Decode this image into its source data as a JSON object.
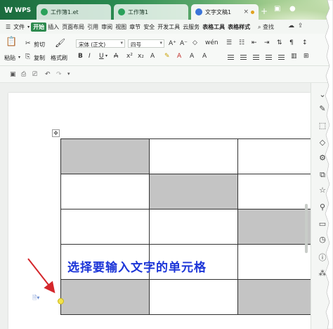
{
  "titlebar": {
    "app_label": "WPS",
    "tabs": [
      {
        "label": "工作簿1.et"
      },
      {
        "label": "工作簿1"
      },
      {
        "label": "文字文稿1"
      }
    ],
    "add_tab": "+"
  },
  "menu": {
    "file": "文件",
    "items": [
      "开始",
      "插入",
      "页面布局",
      "引用",
      "审阅",
      "视图",
      "章节",
      "安全",
      "开发工具",
      "云服务",
      "表格工具",
      "表格样式"
    ],
    "search": "查找"
  },
  "ribbon": {
    "paste": "粘贴",
    "cut": "剪切",
    "copy": "复制",
    "format_painter": "格式刷",
    "font_name": "宋体 (正文)",
    "font_size": "四号",
    "bold": "B",
    "italic": "I",
    "underline": "U"
  },
  "document": {
    "caption": "选择要输入文字的单元格",
    "table": {
      "rows": 5,
      "cols": 3,
      "shaded": [
        [
          true,
          false,
          false
        ],
        [
          false,
          true,
          false
        ],
        [
          false,
          false,
          true
        ],
        [
          false,
          false,
          false
        ],
        [
          true,
          false,
          true
        ]
      ]
    },
    "annotation_color": "#1c35d8",
    "arrow_color": "#d4262b"
  }
}
